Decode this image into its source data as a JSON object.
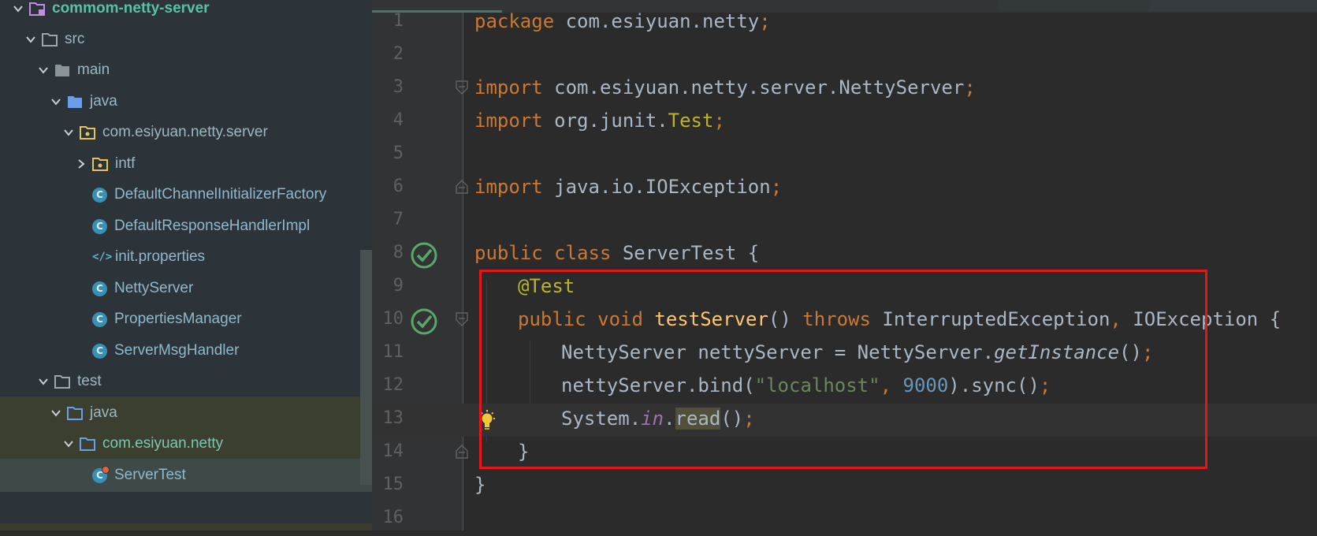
{
  "project_tree": {
    "rows": [
      {
        "label": "commom-netty-server",
        "icon": "module-folder-icon",
        "expanded": true
      },
      {
        "label": "src",
        "icon": "folder-icon",
        "expanded": true
      },
      {
        "label": "main",
        "icon": "folder-icon",
        "expanded": true
      },
      {
        "label": "java",
        "icon": "source-root-folder-icon",
        "expanded": true
      },
      {
        "label": "com.esiyuan.netty.server",
        "icon": "package-icon",
        "expanded": true
      },
      {
        "label": "intf",
        "icon": "package-icon",
        "expanded": false
      },
      {
        "label": "DefaultChannelInitializerFactory",
        "icon": "class-icon"
      },
      {
        "label": "DefaultResponseHandlerImpl",
        "icon": "class-icon"
      },
      {
        "label": "init.properties",
        "icon": "properties-file-icon"
      },
      {
        "label": "NettyServer",
        "icon": "class-icon"
      },
      {
        "label": "PropertiesManager",
        "icon": "class-icon"
      },
      {
        "label": "ServerMsgHandler",
        "icon": "class-icon"
      },
      {
        "label": "test",
        "icon": "folder-icon",
        "expanded": true
      },
      {
        "label": "java",
        "icon": "test-root-folder-icon",
        "expanded": true
      },
      {
        "label": "com.esiyuan.netty",
        "icon": "package-icon",
        "expanded": true
      },
      {
        "label": "ServerTest",
        "icon": "test-class-icon",
        "selected": true
      }
    ]
  },
  "editor": {
    "line_numbers": [
      "1",
      "2",
      "3",
      "4",
      "5",
      "6",
      "7",
      "8",
      "9",
      "10",
      "11",
      "12",
      "13",
      "14",
      "15",
      "16"
    ],
    "tokens": {
      "l1_kw": "package",
      "l1_rest": " com.esiyuan.netty",
      "semi": ";",
      "l3_kw": "import",
      "l3_rest": " com.esiyuan.netty.server.NettyServer",
      "l4_kw": "import",
      "l4_rest": " org.junit.",
      "l4_ann": "Test",
      "l6_kw": "import",
      "l6_rest": " java.io.IOException",
      "l8_kw": "public class",
      "l8_rest": " ServerTest {",
      "l9_ann": "@Test",
      "l10_kw1": "public void",
      "l10_fn": " testServer",
      "l10_paren": "()",
      "l10_kw2": " throws",
      "l10_rest": " InterruptedException",
      "comma": ",",
      "l10_rest2": " IOException {",
      "l11_a": "NettyServer nettyServer = NettyServer.",
      "l11_ital": "getInstance",
      "l11_b": "()",
      "l12_a": "nettyServer.bind(",
      "l12_str": "\"localhost\"",
      "l12_comma": ",",
      "l12_num": " 9000",
      "l12_b": ").sync()",
      "l13_a": "System.",
      "l13_stat": "in",
      "l13_dot": ".",
      "l13_usage": "read",
      "l13_b": "()",
      "brace_close": "}"
    }
  },
  "colors": {
    "keyword": "#cc7832",
    "annotation": "#bbb529",
    "function": "#ffc66d",
    "string": "#6a8759",
    "number": "#6897bb",
    "static_field": "#9876aa",
    "highlight_box": "#e4161a"
  }
}
